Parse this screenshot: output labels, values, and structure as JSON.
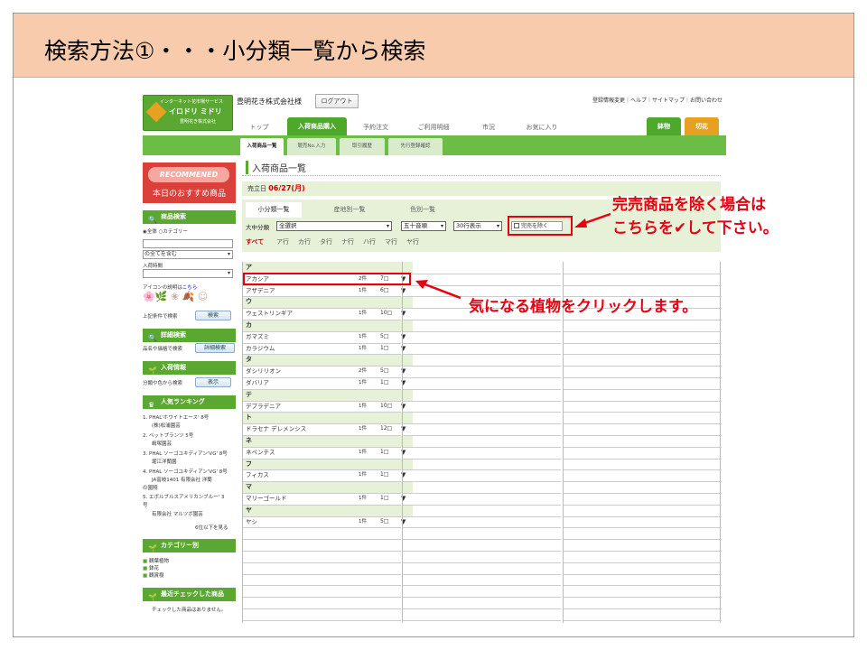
{
  "slide": {
    "title": "検索方法①・・・小分類一覧から検索"
  },
  "header": {
    "logo_line1": "インターネット花市場サービス",
    "logo_line2": "イロドリ ミドリ",
    "logo_line3": "豊明花き株式会社",
    "company": "豊明花き株式会社様",
    "logout": "ログアウト",
    "toplinks": "登録情報変更｜ヘルプ｜サイトマップ｜お問い合わせ"
  },
  "nav": {
    "tabs": [
      "トップ",
      "入荷商品購入",
      "予約注文",
      "ご利用明細",
      "市況",
      "お気に入り"
    ],
    "right_tabs": [
      "鉢物",
      "切花"
    ],
    "subtabs": [
      "入荷商品一覧",
      "競売No.入力",
      "取引履歴",
      "先行登録確認"
    ]
  },
  "sidebar": {
    "reco_top": "RECOMMENED",
    "reco_bottom": "本日のおすすめ商品",
    "product_search_title": "商品検索",
    "radio_all": "全体",
    "radio_category": "カテゴリー",
    "select_all": "の全てを含む",
    "arrival_time": "入荷時間",
    "icon_desc": "アイコンの説明は",
    "icon_desc_link": "こちら",
    "search_label": "上記条件で検索",
    "search_btn": "検索",
    "detail_title": "詳細検索",
    "detail_label": "品名や価格で検索",
    "detail_btn": "詳細検索",
    "arrival_title": "入荷情報",
    "arrival_label": "分類や色から検索",
    "arrival_btn": "表示",
    "ranking_title": "人気ランキング",
    "ranking": [
      "1. PHAL'ホワイトエース' 8号",
      "(株)松浦園芸",
      "2. ペットプランツ 5号",
      "嶋塚園芸",
      "3. PHAL ソーゴユキディアン'VG' 8号",
      "堀江洋蘭園",
      "4. PHAL ソーゴユキディアン'VG' 8号",
      "JA富岐1401 有限会社 洋蘭",
      "の園翔",
      "5. エボルブルスアメリカンブルー' 3",
      "号",
      "有限会社 マルツボ園芸"
    ],
    "ranking_more": "6位以下を見る",
    "category_title": "カテゴリー別",
    "categories": [
      "観葉植物",
      "鉢花",
      "観賞樹"
    ],
    "recent_title": "最近チェックした商品",
    "recent_text": "チェックした商品はありません。"
  },
  "main": {
    "title": "入荷商品一覧",
    "date_label": "売立日",
    "date_value": "06/27(月)",
    "list_tabs": [
      "小分類一覧",
      "産地別一覧",
      "色別一覧"
    ],
    "filter_label": "大中分類",
    "filter_value": "全選択",
    "sort_value": "五十音順",
    "rows_value": "30行表示",
    "soldout_label": "完売を除く",
    "kana": [
      "すべて",
      "ア行",
      "カ行",
      "タ行",
      "ナ行",
      "ハ行",
      "マ行",
      "ヤ行"
    ]
  },
  "product_list": [
    {
      "type": "head",
      "name": "ア"
    },
    {
      "type": "item",
      "name": "アカシア",
      "count": "2件",
      "check": "7□",
      "toggle": "▼"
    },
    {
      "type": "item",
      "name": "アザデニア",
      "count": "1件",
      "check": "6□",
      "toggle": "▼"
    },
    {
      "type": "head",
      "name": "ウ"
    },
    {
      "type": "item",
      "name": "ウェストリンギア",
      "count": "1件",
      "check": "10□",
      "toggle": "▼"
    },
    {
      "type": "head",
      "name": "カ"
    },
    {
      "type": "item",
      "name": "ガマズミ",
      "count": "1件",
      "check": "5□",
      "toggle": "▼"
    },
    {
      "type": "item",
      "name": "カラジウム",
      "count": "1件",
      "check": "1□",
      "toggle": "▼"
    },
    {
      "type": "head",
      "name": "タ"
    },
    {
      "type": "item",
      "name": "ダシリリオン",
      "count": "2件",
      "check": "5□",
      "toggle": "▼"
    },
    {
      "type": "item",
      "name": "ダバリア",
      "count": "1件",
      "check": "1□",
      "toggle": "▼"
    },
    {
      "type": "head",
      "name": "テ"
    },
    {
      "type": "item",
      "name": "デプラデニア",
      "count": "1件",
      "check": "10□",
      "toggle": "▼"
    },
    {
      "type": "head",
      "name": "ト"
    },
    {
      "type": "item",
      "name": "ドラセナ デレメンシス",
      "count": "1件",
      "check": "12□",
      "toggle": "▼"
    },
    {
      "type": "head",
      "name": "ネ"
    },
    {
      "type": "item",
      "name": "ネペンテス",
      "count": "1件",
      "check": "1□",
      "toggle": "▼"
    },
    {
      "type": "head",
      "name": "フ"
    },
    {
      "type": "item",
      "name": "フィカス",
      "count": "1件",
      "check": "1□",
      "toggle": "▼"
    },
    {
      "type": "head",
      "name": "マ"
    },
    {
      "type": "item",
      "name": "マリーゴールド",
      "count": "1件",
      "check": "1□",
      "toggle": "▼"
    },
    {
      "type": "head",
      "name": "ヤ"
    },
    {
      "type": "item",
      "name": "ヤシ",
      "count": "1件",
      "check": "5□",
      "toggle": "▼"
    }
  ],
  "annotations": {
    "soldout_line1": "完売商品を除く場合は",
    "soldout_line2": "こちらを✔して下さい。",
    "click_plant": "気になる植物をクリックします。",
    "color": "#e60012"
  },
  "colors": {
    "header_bg": "#f8cbad",
    "green": "#5aa832",
    "annotation_red": "#e60012"
  }
}
